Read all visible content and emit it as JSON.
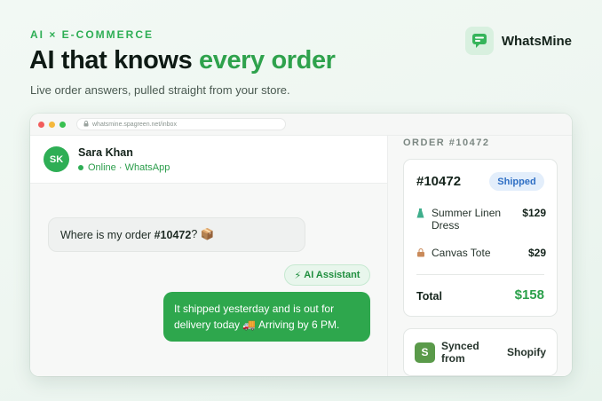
{
  "hero": {
    "eyebrow": "AI × E-COMMERCE",
    "headline_main": "AI that knows ",
    "headline_accent": "every order",
    "subhead": "Live order answers, pulled straight from your store."
  },
  "brand": {
    "name": "WhatsMine",
    "icon": "chat-bubble-icon"
  },
  "browser": {
    "url": "whatsmine.spagreen.net/inbox"
  },
  "chat": {
    "contact": {
      "initials": "SK",
      "name": "Sara Khan",
      "status": "Online · WhatsApp"
    },
    "incoming": {
      "prefix": "Where is my order ",
      "order_ref": "#10472",
      "suffix": "? 📦"
    },
    "ai_badge": {
      "icon": "⚡",
      "label": "AI Assistant"
    },
    "outgoing": "It shipped yesterday and is out for delivery today 🚚 Arriving by 6 PM."
  },
  "order_panel": {
    "label": "ORDER #10472",
    "order_id": "#10472",
    "status": "Shipped",
    "items": [
      {
        "name": "Summer Linen Dress",
        "price": "$129",
        "icon": "dress-icon"
      },
      {
        "name": "Canvas Tote",
        "price": "$29",
        "icon": "tote-bag-icon"
      }
    ],
    "total_label": "Total",
    "total_value": "$158"
  },
  "sync": {
    "logo_letter": "S",
    "label": "Synced from",
    "platform": "Shopify"
  },
  "colors": {
    "accent": "#2ea24c",
    "bubble_out": "#2ea74d",
    "badge_blue": "#2f6fc4"
  }
}
